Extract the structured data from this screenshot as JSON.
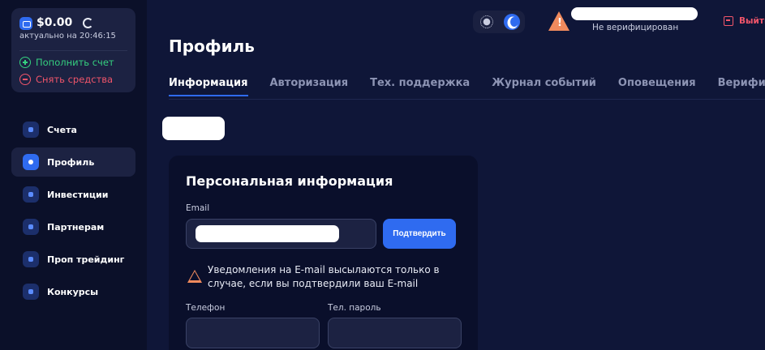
{
  "sidebar": {
    "balance": {
      "amount": "$0.00",
      "updated": "актуально на 20:46:15",
      "deposit_label": "Пополнить счет",
      "withdraw_label": "Снять средства"
    },
    "nav": [
      {
        "label": "Счета",
        "icon": "home-icon"
      },
      {
        "label": "Профиль",
        "icon": "user-icon",
        "active": true
      },
      {
        "label": "Инвестиции",
        "icon": "rocket-icon"
      },
      {
        "label": "Партнерам",
        "icon": "card-icon"
      },
      {
        "label": "Проп трейдинг",
        "icon": "chart-icon"
      },
      {
        "label": "Конкурсы",
        "icon": "gift-icon"
      }
    ]
  },
  "header": {
    "verify_status": "Не верифицирован",
    "logout_label": "Выйти",
    "theme": "dark"
  },
  "main": {
    "title": "Профиль",
    "tabs": [
      {
        "label": "Информация",
        "active": true
      },
      {
        "label": "Авторизация"
      },
      {
        "label": "Тех. поддержка"
      },
      {
        "label": "Журнал событий"
      },
      {
        "label": "Оповещения"
      },
      {
        "label": "Верификация"
      }
    ],
    "personal": {
      "title": "Персональная информация",
      "email_label": "Email",
      "confirm_label": "Подтвердить",
      "notice": "Уведомления на E-mail высылаются только в случае, если вы подтвердили ваш E-mail",
      "phone_label": "Телефон",
      "password_label": "Тел. пароль"
    }
  },
  "colors": {
    "background": "#0f1638",
    "sidebar": "#0b1029",
    "accent": "#2f6bf0",
    "success": "#35d07f",
    "danger": "#f0556a",
    "warning": "#f08a5d"
  }
}
